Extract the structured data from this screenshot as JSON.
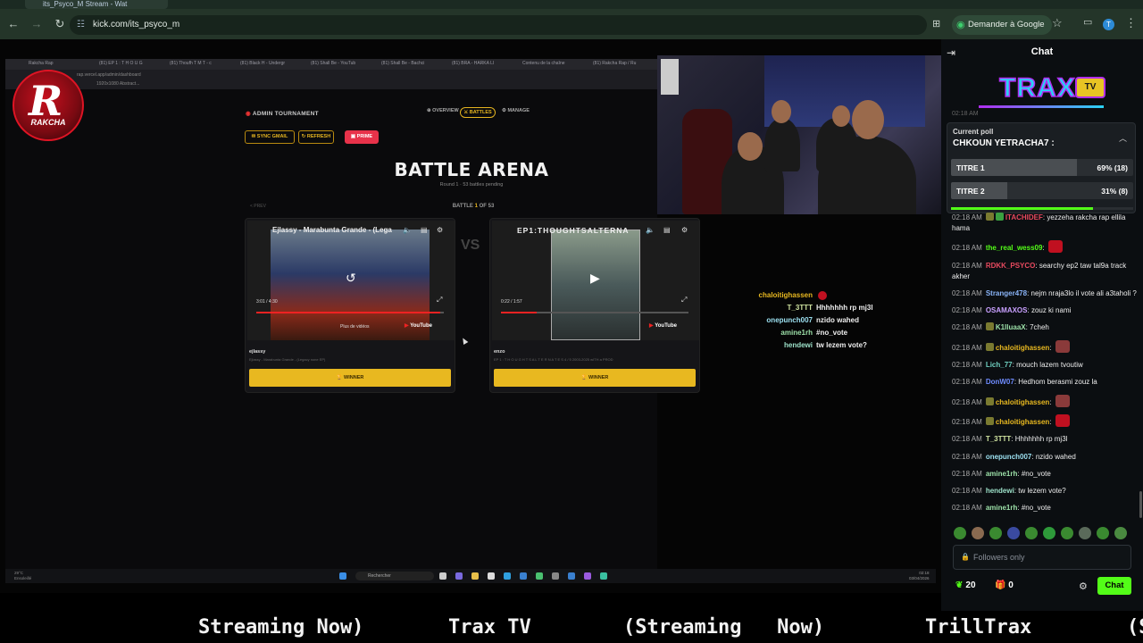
{
  "browser": {
    "tab_title": "its_Psyco_M Stream - Wat",
    "url": "kick.com/its_psyco_m",
    "ask_google": "Demander à Google",
    "profile_initial": "T"
  },
  "stream": {
    "inner_tabs": [
      "Rakcha Rap",
      "(81) EP 1 : T H O U G",
      "(81) Thoufh T M T - c",
      "(81) Black H - Undergr",
      "(81) Shall Be - YouTub",
      "(81) Shall Be - Bachci",
      "(81) BRA - HARKA LI",
      "Contenu de la chaîne",
      "(81) Rakcha Rap / Ru"
    ],
    "inner_url": "rap.vercel.app/admin/dashboard",
    "inner_bookmark": "1920x1080 Abstract...",
    "logo_text": "RAKCHA",
    "logo_letter": "R",
    "admin_title": "ADMIN TOURNAMENT",
    "nav": {
      "overview": "OVERVIEW",
      "battles": "BATTLES",
      "manage": "MANAGE"
    },
    "buttons": {
      "sync_gmail": "SYNC GMAIL",
      "refresh": "REFRESH",
      "prime": "PRIME"
    },
    "arena_title": "BATTLE ARENA",
    "arena_subtitle": "Round 1 · 53 battles pending",
    "prev_label": "< PREV",
    "battle_label": "BATTLE",
    "battle_current": "1",
    "battle_of": "OF",
    "battle_total": "53",
    "vs": "VS",
    "left_card": {
      "video_title": "Ejlassy - Marabunta Grande - (Lega",
      "time": "3:01 / 4:30",
      "more_videos": "Plus de vidéos",
      "youtube": "YouTube",
      "name": "ejlassy",
      "meta": "Ejlassy - Marabunta Grande - (Legacy none EP)",
      "winner": "WINNER",
      "progress": 0.98
    },
    "right_card": {
      "video_title": "EP1:THOUGHTSALTERNA",
      "time": "0:22 / 1:57",
      "youtube": "YouTube",
      "name": "enzo",
      "meta": "EP 1 : T H O U G H T S A L T E R N A T E S 4 / 5 2003-2025 wITH a PROD",
      "winner": "WINNER",
      "progress": 0.19
    },
    "overlay_chat": [
      {
        "user": "chaloitighassen",
        "msg": "",
        "color": "#e8b820"
      },
      {
        "user": "T_3TTT",
        "msg": "Hhhhhhh rp mj3l",
        "color": "#cfe3a0"
      },
      {
        "user": "onepunch007",
        "msg": "nzido wahed",
        "color": "#9ce0f0"
      },
      {
        "user": "amine1rh",
        "msg": "#no_vote",
        "color": "#9ce0a8"
      },
      {
        "user": "hendewi",
        "msg": "tw lezem vote?",
        "color": "#9ce0c8"
      }
    ],
    "taskbar": {
      "search": "Rechercher",
      "weather_temp": "29°C",
      "weather_desc": "Ensoleillé",
      "clock_time": "02:18",
      "clock_date": "03/04/2026"
    }
  },
  "ticker": [
    "Streaming Now)",
    "Trax TV",
    "(Streaming   Now)",
    "TrillTrax",
    "(S"
  ],
  "chat": {
    "title": "Chat",
    "banner_text": "TRAX",
    "banner_tv": "TV",
    "partial_msg": "02:18 AM",
    "poll": {
      "label": "Current poll",
      "question": "CHKOUN YETRACHA7 :",
      "options": [
        {
          "label": "TITRE 1",
          "pct_text": "69% (18)",
          "pct": 0.69
        },
        {
          "label": "TITRE 2",
          "pct_text": "31% (8)",
          "pct": 0.31
        }
      ],
      "time_progress": 0.78
    },
    "messages": [
      {
        "time": "02:18 AM",
        "user": "ITACHIDEF",
        "msg": "yezzeha rakcha rap ellila hama",
        "color": "#e84a5f",
        "badges": 2
      },
      {
        "time": "02:18 AM",
        "user": "the_real_wess09",
        "msg": "",
        "color": "#53fc18",
        "emote": true
      },
      {
        "time": "02:18 AM",
        "user": "RDKK_PSYCO",
        "msg": "searchy ep2 taw tal9a track akher",
        "color": "#e84a5f"
      },
      {
        "time": "02:18 AM",
        "user": "Stranger478",
        "msg": "nejm nraja3lo il vote ali a3taholi ?",
        "color": "#8ab4f8"
      },
      {
        "time": "02:18 AM",
        "user": "OSAMAXOS",
        "msg": "zouz ki nami",
        "color": "#c9a0ff"
      },
      {
        "time": "02:18 AM",
        "user": "K1lluaaX",
        "msg": "7cheh",
        "color": "#9ce0a8",
        "badges": 1
      },
      {
        "time": "02:18 AM",
        "user": "chaloitighassen",
        "msg": "",
        "color": "#e8b820",
        "badges": 1,
        "emote": true
      },
      {
        "time": "02:18 AM",
        "user": "Lich_77",
        "msg": "mouch lazem tvoutiw",
        "color": "#6fd0c0"
      },
      {
        "time": "02:18 AM",
        "user": "DonW07",
        "msg": "Hedhom berasmi zouz la",
        "color": "#6f8cff"
      },
      {
        "time": "02:18 AM",
        "user": "chaloitighassen",
        "msg": "",
        "color": "#e8b820",
        "badges": 1,
        "emote": true
      },
      {
        "time": "02:18 AM",
        "user": "chaloitighassen",
        "msg": "",
        "color": "#e8b820",
        "badges": 1,
        "emote": true
      },
      {
        "time": "02:18 AM",
        "user": "T_3TTT",
        "msg": "Hhhhhhh rp mj3l",
        "color": "#cfe3a0"
      },
      {
        "time": "02:18 AM",
        "user": "onepunch007",
        "msg": "nzido wahed",
        "color": "#9ce0f0"
      },
      {
        "time": "02:18 AM",
        "user": "amine1rh",
        "msg": "#no_vote",
        "color": "#9ce0a8"
      },
      {
        "time": "02:18 AM",
        "user": "hendewi",
        "msg": "tw lezem vote?",
        "color": "#9ce0c8"
      },
      {
        "time": "02:18 AM",
        "user": "amine1rh",
        "msg": "#no_vote",
        "color": "#9ce0a8"
      }
    ],
    "input_placeholder": "Followers only",
    "points": "20",
    "gifts": "0",
    "send_label": "Chat",
    "accent": "#53fc18"
  }
}
